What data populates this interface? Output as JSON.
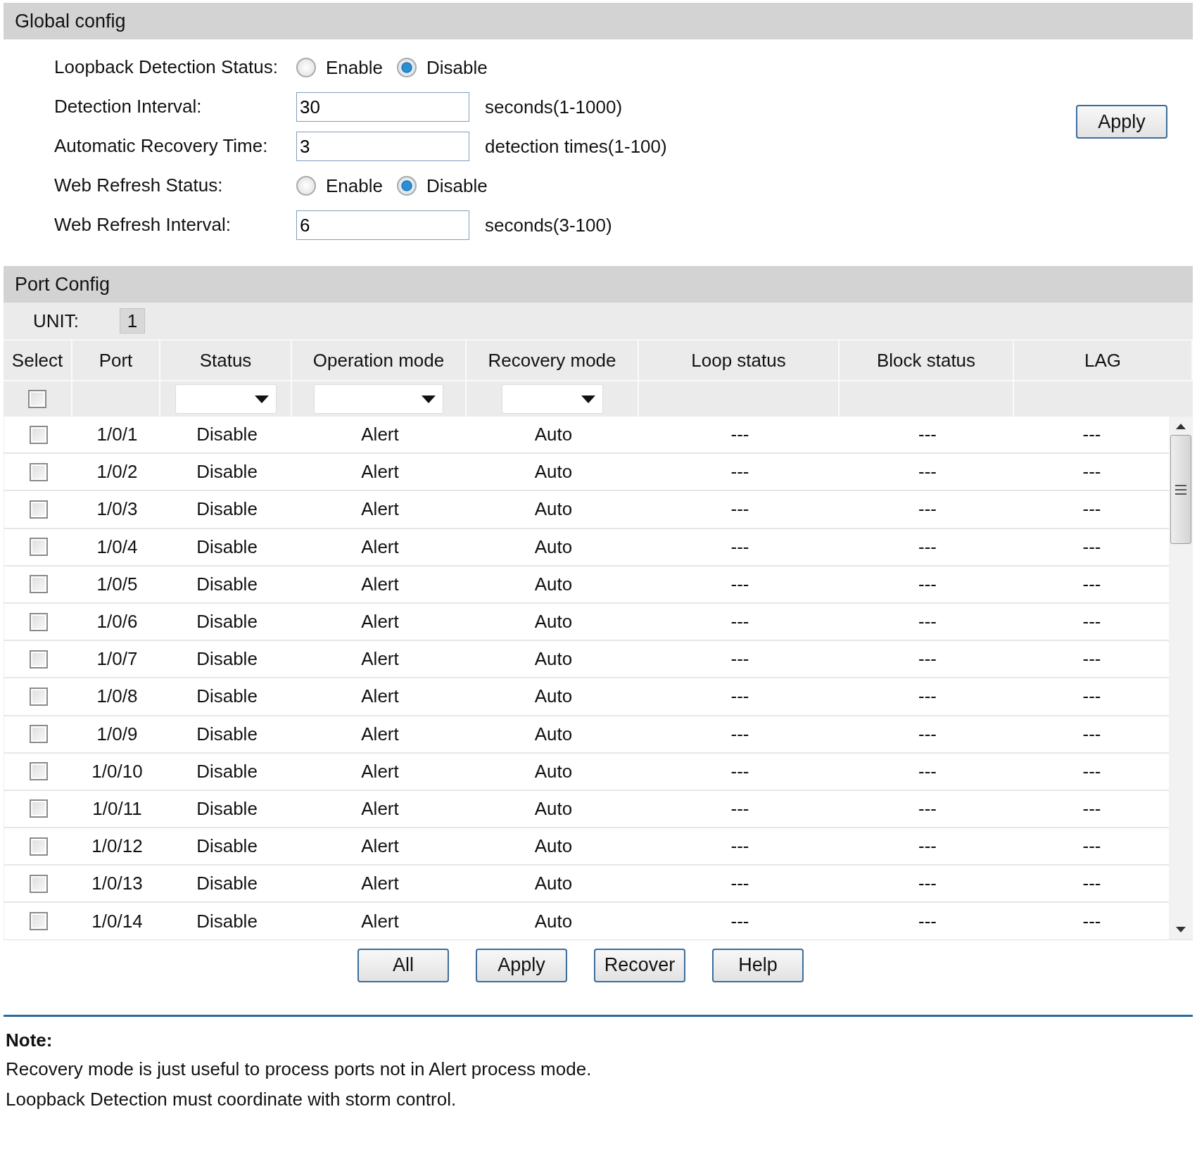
{
  "global_config": {
    "title": "Global config",
    "fields": [
      {
        "kind": "radio",
        "label": "Loopback Detection Status:",
        "options": [
          {
            "label": "Enable",
            "selected": false
          },
          {
            "label": "Disable",
            "selected": true
          }
        ]
      },
      {
        "kind": "text",
        "label": "Detection Interval:",
        "value": "30",
        "hint": "seconds(1-1000)"
      },
      {
        "kind": "text",
        "label": "Automatic Recovery Time:",
        "value": "3",
        "hint": "detection times(1-100)"
      },
      {
        "kind": "radio",
        "label": "Web Refresh Status:",
        "options": [
          {
            "label": "Enable",
            "selected": false
          },
          {
            "label": "Disable",
            "selected": true
          }
        ]
      },
      {
        "kind": "text",
        "label": "Web Refresh Interval:",
        "value": "6",
        "hint": "seconds(3-100)"
      }
    ],
    "apply_button": "Apply"
  },
  "port_config": {
    "title": "Port Config",
    "unit_label": "UNIT:",
    "unit": "1",
    "columns": [
      "Select",
      "Port",
      "Status",
      "Operation mode",
      "Recovery mode",
      "Loop status",
      "Block status",
      "LAG"
    ],
    "select_all_checked": false,
    "rows": [
      {
        "checked": false,
        "port": "1/0/1",
        "status": "Disable",
        "operation_mode": "Alert",
        "recovery_mode": "Auto",
        "loop_status": "---",
        "block_status": "---",
        "lag": "---"
      },
      {
        "checked": false,
        "port": "1/0/2",
        "status": "Disable",
        "operation_mode": "Alert",
        "recovery_mode": "Auto",
        "loop_status": "---",
        "block_status": "---",
        "lag": "---"
      },
      {
        "checked": false,
        "port": "1/0/3",
        "status": "Disable",
        "operation_mode": "Alert",
        "recovery_mode": "Auto",
        "loop_status": "---",
        "block_status": "---",
        "lag": "---"
      },
      {
        "checked": false,
        "port": "1/0/4",
        "status": "Disable",
        "operation_mode": "Alert",
        "recovery_mode": "Auto",
        "loop_status": "---",
        "block_status": "---",
        "lag": "---"
      },
      {
        "checked": false,
        "port": "1/0/5",
        "status": "Disable",
        "operation_mode": "Alert",
        "recovery_mode": "Auto",
        "loop_status": "---",
        "block_status": "---",
        "lag": "---"
      },
      {
        "checked": false,
        "port": "1/0/6",
        "status": "Disable",
        "operation_mode": "Alert",
        "recovery_mode": "Auto",
        "loop_status": "---",
        "block_status": "---",
        "lag": "---"
      },
      {
        "checked": false,
        "port": "1/0/7",
        "status": "Disable",
        "operation_mode": "Alert",
        "recovery_mode": "Auto",
        "loop_status": "---",
        "block_status": "---",
        "lag": "---"
      },
      {
        "checked": false,
        "port": "1/0/8",
        "status": "Disable",
        "operation_mode": "Alert",
        "recovery_mode": "Auto",
        "loop_status": "---",
        "block_status": "---",
        "lag": "---"
      },
      {
        "checked": false,
        "port": "1/0/9",
        "status": "Disable",
        "operation_mode": "Alert",
        "recovery_mode": "Auto",
        "loop_status": "---",
        "block_status": "---",
        "lag": "---"
      },
      {
        "checked": false,
        "port": "1/0/10",
        "status": "Disable",
        "operation_mode": "Alert",
        "recovery_mode": "Auto",
        "loop_status": "---",
        "block_status": "---",
        "lag": "---"
      },
      {
        "checked": false,
        "port": "1/0/11",
        "status": "Disable",
        "operation_mode": "Alert",
        "recovery_mode": "Auto",
        "loop_status": "---",
        "block_status": "---",
        "lag": "---"
      },
      {
        "checked": false,
        "port": "1/0/12",
        "status": "Disable",
        "operation_mode": "Alert",
        "recovery_mode": "Auto",
        "loop_status": "---",
        "block_status": "---",
        "lag": "---"
      },
      {
        "checked": false,
        "port": "1/0/13",
        "status": "Disable",
        "operation_mode": "Alert",
        "recovery_mode": "Auto",
        "loop_status": "---",
        "block_status": "---",
        "lag": "---"
      },
      {
        "checked": false,
        "port": "1/0/14",
        "status": "Disable",
        "operation_mode": "Alert",
        "recovery_mode": "Auto",
        "loop_status": "---",
        "block_status": "---",
        "lag": "---"
      }
    ],
    "buttons": [
      "All",
      "Apply",
      "Recover",
      "Help"
    ]
  },
  "note": {
    "title": "Note:",
    "lines": [
      "Recovery mode is just useful to process ports not in Alert process mode.",
      "Loopback Detection must coordinate with storm control."
    ]
  }
}
